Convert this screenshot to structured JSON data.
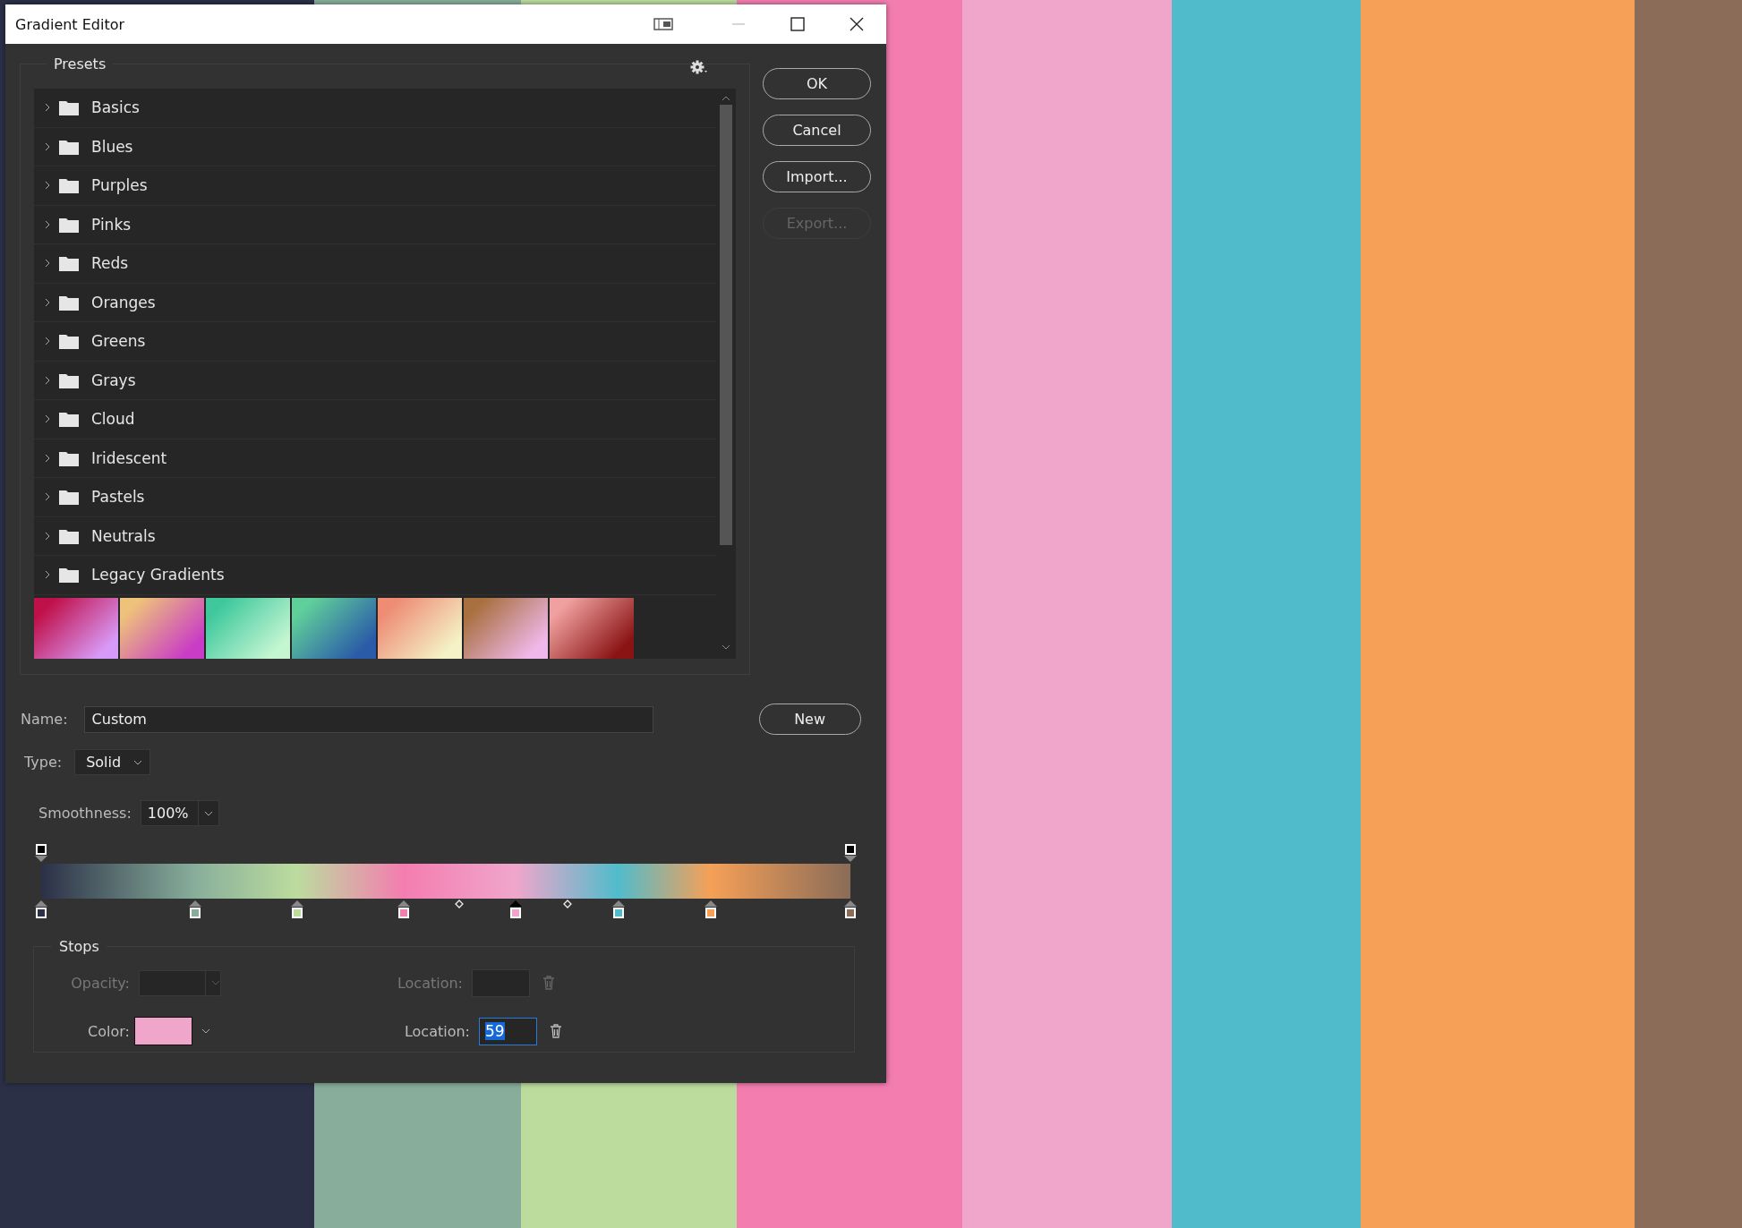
{
  "background": {
    "stripes": [
      {
        "color": "#2b3047"
      },
      {
        "color": "#88ae9b"
      },
      {
        "color": "#bcdc9e"
      },
      {
        "color": "#f47db0"
      },
      {
        "color": "#f0a6cb"
      },
      {
        "color": "#50bccb"
      },
      {
        "color": "#f6a057"
      },
      {
        "color": "#8a6c58"
      }
    ]
  },
  "window": {
    "title": "Gradient Editor"
  },
  "presets": {
    "title": "Presets",
    "folders": [
      {
        "label": "Basics",
        "expanded": false
      },
      {
        "label": "Blues",
        "expanded": false
      },
      {
        "label": "Purples",
        "expanded": false
      },
      {
        "label": "Pinks",
        "expanded": false
      },
      {
        "label": "Reds",
        "expanded": false
      },
      {
        "label": "Oranges",
        "expanded": false
      },
      {
        "label": "Greens",
        "expanded": false
      },
      {
        "label": "Grays",
        "expanded": false
      },
      {
        "label": "Cloud",
        "expanded": false
      },
      {
        "label": "Iridescent",
        "expanded": false
      },
      {
        "label": "Pastels",
        "expanded": false
      },
      {
        "label": "Neutrals",
        "expanded": false
      },
      {
        "label": "Legacy Gradients",
        "expanded": false
      }
    ],
    "swatches": [
      {
        "color": "#c0104a"
      },
      {
        "color": "#eec27a"
      },
      {
        "color": "#3ec89c"
      },
      {
        "color": "#60d09a"
      },
      {
        "color": "#ee8c74"
      },
      {
        "color": "#a8703e"
      },
      {
        "color": "#f0a0a0"
      }
    ]
  },
  "buttons": [
    {
      "label": "OK",
      "disabled": false
    },
    {
      "label": "Cancel",
      "disabled": false
    },
    {
      "label": "Import...",
      "disabled": false
    },
    {
      "label": "Export...",
      "disabled": true
    }
  ],
  "name": {
    "label": "Name:",
    "value": "Custom"
  },
  "new_button": "New",
  "type": {
    "label": "Type:",
    "value": "Solid"
  },
  "smoothness": {
    "label": "Smoothness:",
    "value": "100%"
  },
  "gradient": {
    "opacity_stops": [
      {
        "selected": false
      },
      {
        "selected": false
      }
    ],
    "color_stops": [
      {
        "color": "#2b3047",
        "selected": false
      },
      {
        "color": "#88ae9b",
        "selected": false
      },
      {
        "color": "#bcdc9e",
        "selected": false
      },
      {
        "color": "#f47db0",
        "selected": false
      },
      {
        "color": "#f0a6cb",
        "selected": true
      },
      {
        "color": "#50bccb",
        "selected": false
      },
      {
        "color": "#f6a057",
        "selected": false
      },
      {
        "color": "#8a6c58",
        "selected": false
      }
    ],
    "midpoints": [
      {
        "kind": "diamond"
      },
      {
        "kind": "diamond"
      }
    ]
  },
  "stops": {
    "title": "Stops",
    "opacity_row": {
      "label": "Opacity:",
      "location_label": "Location:",
      "disabled": true
    },
    "color_row": {
      "label": "Color:",
      "color": "#f0a6cb",
      "location_label": "Location:",
      "location": "59",
      "selected": true,
      "disabled": false
    }
  }
}
